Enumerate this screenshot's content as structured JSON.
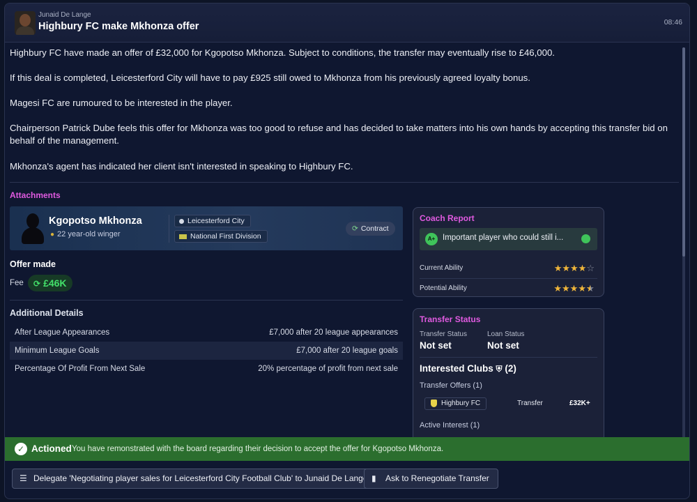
{
  "header": {
    "sender": "Junaid De Lange",
    "title": "Highbury FC make Mkhonza offer",
    "time": "08:46"
  },
  "body": {
    "paragraphs": [
      "Highbury FC have made an offer of £32,000 for Kgopotso Mkhonza. Subject to conditions, the transfer may eventually rise to £46,000.",
      "If this deal is completed, Leicesterford City will have to pay £925 still owed to Mkhonza from his previously agreed loyalty bonus.",
      "Magesi FC are rumoured to be interested in the player.",
      "Chairperson Patrick Dube feels this offer for Mkhonza was too good to refuse and has decided to take matters into his own hands by accepting this transfer bid on behalf of the management.",
      "Mkhonza's agent has indicated her client isn't interested in speaking to Highbury FC."
    ]
  },
  "attachments": {
    "label": "Attachments",
    "player": {
      "name": "Kgopotso Mkhonza",
      "meta": "22 year-old winger",
      "club": "Leicesterford City",
      "league": "National First Division",
      "contract_label": "Contract"
    },
    "offer": {
      "label": "Offer made",
      "fee_label": "Fee",
      "fee_value": "£46K"
    },
    "additional": {
      "label": "Additional Details",
      "rows": [
        {
          "label": "After League Appearances",
          "value": "£7,000 after 20 league appearances"
        },
        {
          "label": "Minimum League Goals",
          "value": "£7,000 after 20 league goals"
        },
        {
          "label": "Percentage Of Profit From Next Sale",
          "value": "20% percentage of profit from next sale"
        }
      ]
    }
  },
  "coach_report": {
    "title": "Coach Report",
    "grade": "A+",
    "text": "Important player who could still i...",
    "current_ability_label": "Current Ability",
    "current_ability_stars": 4,
    "potential_ability_label": "Potential Ability",
    "potential_ability_stars": 4.5
  },
  "transfer_status": {
    "title": "Transfer Status",
    "transfer_status_label": "Transfer Status",
    "transfer_status_value": "Not set",
    "loan_status_label": "Loan Status",
    "loan_status_value": "Not set",
    "interested_clubs": "Interested Clubs",
    "interested_count": "(2)",
    "transfer_offers": "Transfer Offers (1)",
    "offer_club": "Highbury FC",
    "offer_type": "Transfer",
    "offer_value": "£32K+",
    "active_interest": "Active Interest (1)"
  },
  "actioned": {
    "label": "Actioned",
    "text": "You have remonstrated with the board regarding their decision to accept the offer for Kgopotso Mkhonza."
  },
  "buttons": {
    "delegate": "Delegate 'Negotiating player sales for Leicesterford City Football Club' to Junaid De Lange",
    "renegotiate": "Ask to Renegotiate Transfer"
  },
  "colors": {
    "accent_pink": "#e05ae0",
    "success_green": "#43e06a",
    "actioned_bar": "#2b6e2e",
    "star": "#f0b63a"
  },
  "icons": {
    "sender": "avatar",
    "contract": "refresh-icon",
    "fee": "refresh-icon",
    "grade": "grade-badge",
    "delegate": "person-list-icon",
    "renegotiate": "chat-icon"
  }
}
